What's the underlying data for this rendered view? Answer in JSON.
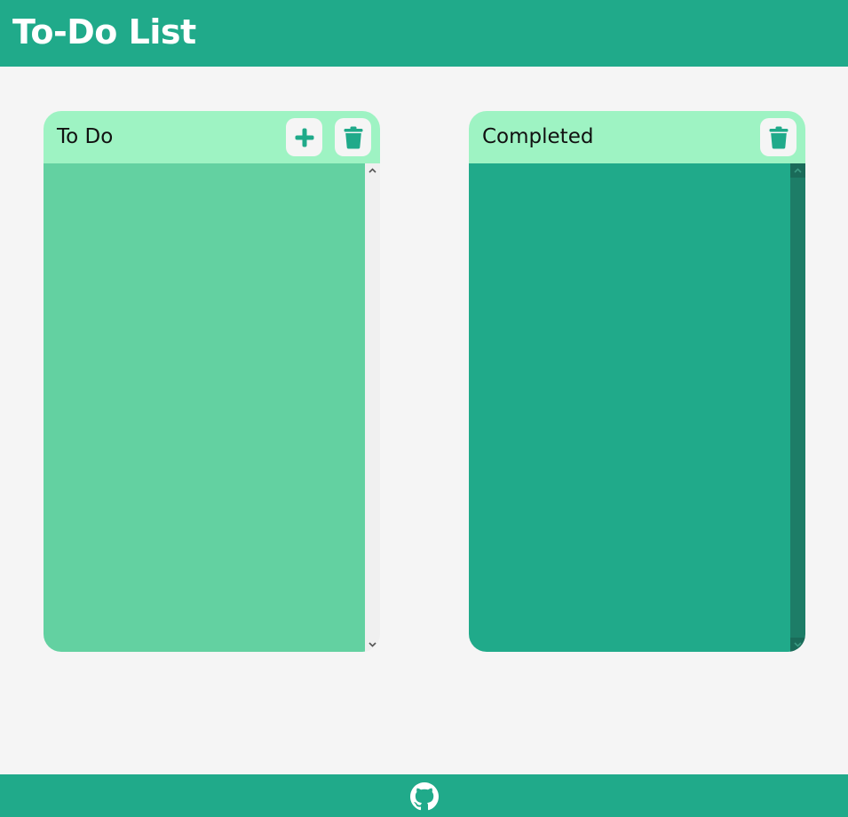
{
  "header": {
    "title": "To-Do List"
  },
  "todo_panel": {
    "title": "To Do",
    "add_icon": "plus-icon",
    "clear_icon": "trash-icon",
    "items": []
  },
  "completed_panel": {
    "title": "Completed",
    "clear_icon": "trash-icon",
    "items": []
  },
  "footer": {
    "link_icon": "github-icon"
  },
  "colors": {
    "primary": "#20aa8a",
    "panel_header": "#9ef3c3",
    "todo_body": "#63d1a1",
    "page_background": "#f5f5f5",
    "button_background": "#f5f5f5"
  }
}
